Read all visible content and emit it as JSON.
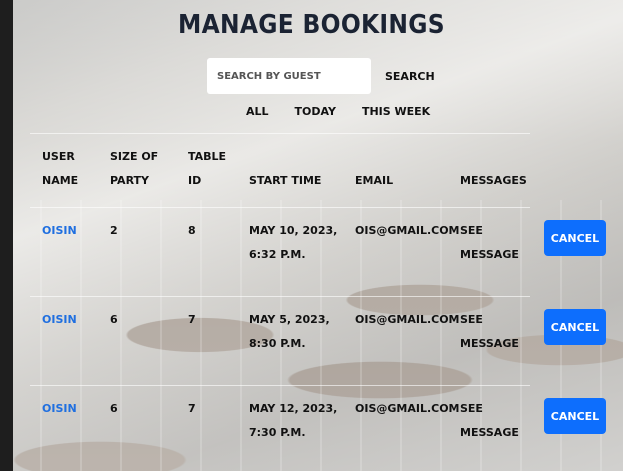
{
  "page": {
    "title": "MANAGE BOOKINGS"
  },
  "search": {
    "placeholder": "SEARCH BY GUEST",
    "value": "",
    "button_label": "SEARCH"
  },
  "filters": [
    "ALL",
    "TODAY",
    "THIS WEEK"
  ],
  "table": {
    "headers": {
      "user_name": [
        "USER",
        "NAME"
      ],
      "party_size": [
        "SIZE OF",
        "PARTY"
      ],
      "table_id": [
        "TABLE",
        "ID"
      ],
      "start_time": "START TIME",
      "email": "EMAIL",
      "messages": "MESSAGES"
    },
    "rows": [
      {
        "user": "OISIN",
        "party": "2",
        "table": "8",
        "time": [
          "MAY 10, 2023,",
          "6:32 P.M."
        ],
        "email": "OIS@GMAIL.COM",
        "message_label": [
          "SEE",
          "MESSAGE"
        ],
        "action": "CANCEL"
      },
      {
        "user": "OISIN",
        "party": "6",
        "table": "7",
        "time": [
          "MAY 5, 2023,",
          "8:30 P.M."
        ],
        "email": "OIS@GMAIL.COM",
        "message_label": [
          "SEE",
          "MESSAGE"
        ],
        "action": "CANCEL"
      },
      {
        "user": "OISIN",
        "party": "6",
        "table": "7",
        "time": [
          "MAY 12, 2023,",
          "7:30 P.M."
        ],
        "email": "OIS@GMAIL.COM",
        "message_label": [
          "SEE",
          "MESSAGE"
        ],
        "action": "CANCEL"
      }
    ]
  }
}
